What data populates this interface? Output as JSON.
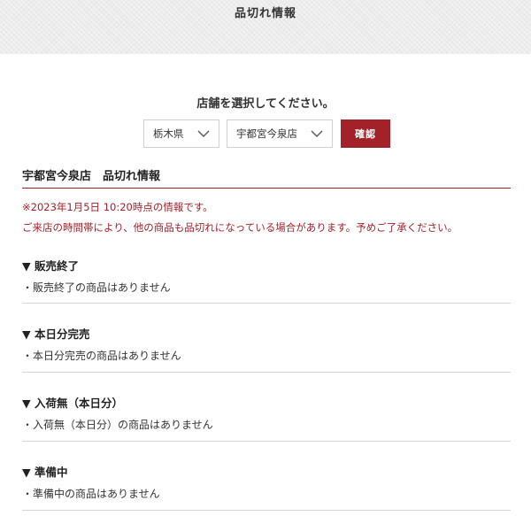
{
  "header": {
    "title": "品切れ情報"
  },
  "selector": {
    "prompt": "店舗を選択してください。",
    "prefecture": "栃木県",
    "store": "宇都宮今泉店",
    "confirm_label": "確認"
  },
  "section": {
    "title": "宇都宮今泉店　品切れ情報",
    "timestamp_notice": "※2023年1月5日 10:20時点の情報です。",
    "warning_notice": "ご来店の時間帯により、他の商品も品切れになっている場合があります。予めご了承ください。"
  },
  "categories": [
    {
      "heading": "▼ 販売終了",
      "message": "・販売終了の商品はありません"
    },
    {
      "heading": "▼ 本日分完売",
      "message": "・本日分完売の商品はありません"
    },
    {
      "heading": "▼ 入荷無（本日分）",
      "message": "・入荷無（本日分）の商品はありません"
    },
    {
      "heading": "▼ 準備中",
      "message": "・準備中の商品はありません"
    }
  ],
  "colors": {
    "accent": "#a3222a",
    "header_bg": "#ececec",
    "rule": "#d4d4d4"
  },
  "icons": {
    "select_chevron": "chevron-down-icon"
  }
}
